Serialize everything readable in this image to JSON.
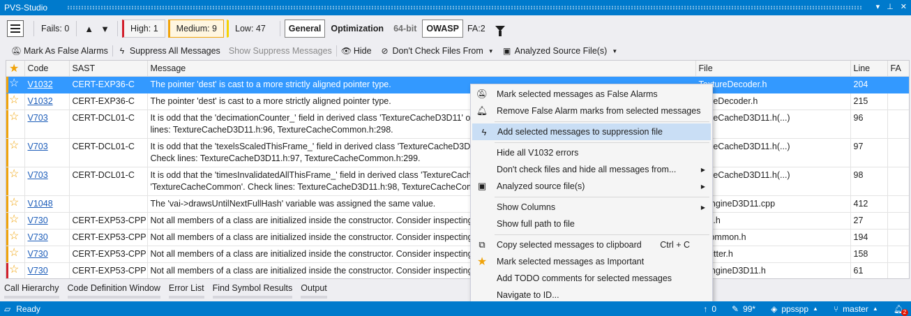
{
  "window": {
    "title": "PVS-Studio",
    "buttons": [
      "▾",
      "⊥",
      "✕"
    ]
  },
  "toolbar": {
    "fails": "Fails: 0",
    "levels": {
      "high": "High: 1",
      "medium": "Medium: 9",
      "low": "Low: 47"
    },
    "categories": {
      "general": "General",
      "optimization": "Optimization",
      "bit64": "64-bit",
      "owasp": "OWASP",
      "fa": "FA:2"
    }
  },
  "actions": {
    "mark_false": "Mark As False Alarms",
    "suppress_all": "Suppress All Messages",
    "show_suppress": "Show Suppress Messages",
    "hide": "Hide",
    "dont_check": "Don't Check Files From",
    "analyzed": "Analyzed Source File(s)"
  },
  "table": {
    "headers": {
      "code": "Code",
      "sast": "SAST",
      "message": "Message",
      "file": "File",
      "line": "Line",
      "fa": "FA"
    },
    "rows": [
      {
        "code": "V1032",
        "sast": "CERT-EXP36-C",
        "msg": "The pointer 'dest' is cast to a more strictly aligned pointer type.",
        "file": "TextureDecoder.h",
        "line": "204"
      },
      {
        "code": "V1032",
        "sast": "CERT-EXP36-C",
        "msg": "The pointer 'dest' is cast to a more strictly aligned pointer type.",
        "file": "xtureDecoder.h",
        "line": "215"
      },
      {
        "code": "V703",
        "sast": "CERT-DCL01-C",
        "msg": "It is odd that the 'decimationCounter_' field in derived class 'TextureCacheD3D11' ove",
        "msg2": "lines: TextureCacheD3D11.h:96, TextureCacheCommon.h:298.",
        "file": "xtureCacheD3D11.h(...)",
        "line": "96"
      },
      {
        "code": "V703",
        "sast": "CERT-DCL01-C",
        "msg": "It is odd that the 'texelsScaledThisFrame_' field in derived class 'TextureCacheD3D11' c",
        "msg2": "Check lines: TextureCacheD3D11.h:97, TextureCacheCommon.h:299.",
        "file": "xtureCacheD3D11.h(...)",
        "line": "97"
      },
      {
        "code": "V703",
        "sast": "CERT-DCL01-C",
        "msg": "It is odd that the 'timesInvalidatedAllThisFrame_' field in derived class 'TextureCacheD3",
        "msg2": "'TextureCacheCommon'. Check lines: TextureCacheD3D11.h:98, TextureCacheCommon.h",
        "file": "xtureCacheD3D11.h(...)",
        "line": "98"
      },
      {
        "code": "V1048",
        "sast": "",
        "msg": "The 'vai->drawsUntilNextFullHash' variable was assigned the same value.",
        "file": "wEngineD3D11.cpp",
        "line": "412"
      },
      {
        "code": "V730",
        "sast": "CERT-EXP53-CPP",
        "msg": "Not all members of a class are initialized inside the constructor. Consider inspecting: e",
        "file": "ode.h",
        "line": "27"
      },
      {
        "code": "V730",
        "sast": "CERT-EXP53-CPP",
        "msg": "Not all members of a class are initialized inside the constructor. Consider inspecting: p",
        "file": "eCommon.h",
        "line": "194"
      },
      {
        "code": "V730",
        "sast": "CERT-EXP53-CPP",
        "msg": "Not all members of a class are initialized inside the constructor. Consider inspecting: c",
        "file": "Emitter.h",
        "line": "158"
      },
      {
        "code": "V730",
        "sast": "CERT-EXP53-CPP",
        "msg": "Not all members of a class are initialized inside the constructor. Consider inspecting: h",
        "file": "wEngineD3D11.h",
        "line": "61"
      }
    ],
    "level_colors": [
      "#f0a30a",
      "#f0a30a",
      "#f0a30a",
      "#f0a30a",
      "#f0a30a",
      "#f0a30a",
      "#f0a30a",
      "#f0a30a",
      "#f0a30a",
      "#d21f2b"
    ]
  },
  "context_menu": {
    "items": [
      "Mark selected messages as False Alarms",
      "Remove False Alarm marks from selected messages",
      "Add selected messages to suppression file",
      "Hide all V1032 errors",
      "Don't check files and hide all messages from...",
      "Analyzed source file(s)",
      "Show Columns",
      "Show full path to file",
      "Copy selected messages to clipboard",
      "Mark selected messages as Important",
      "Add TODO comments for selected messages",
      "Navigate to ID..."
    ],
    "copy_shortcut": "Ctrl + C"
  },
  "tabs": [
    "Call Hierarchy",
    "Code Definition Window",
    "Error List",
    "Find Symbol Results",
    "Output"
  ],
  "status": {
    "ready": "Ready",
    "up": "0",
    "pending": "99*",
    "repo": "ppsspp",
    "branch": "master",
    "notifications": "2"
  }
}
